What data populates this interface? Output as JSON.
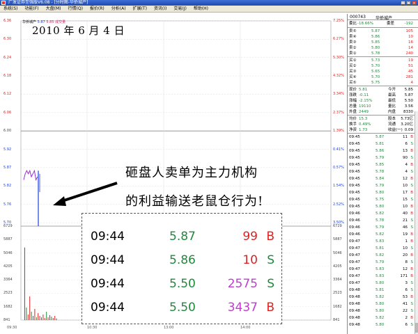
{
  "window": {
    "title": "广发证券至强版V6.08 - [分时图-华侨城产]",
    "controls": [
      "_",
      "□",
      "×"
    ]
  },
  "menu": [
    "系统(S)",
    "功能(F)",
    "大盘(M)",
    "行情(Q)",
    "报价(R)",
    "分析(A)",
    "扩展(T)",
    "资讯(I)",
    "交易(J)",
    "帮助(H)"
  ],
  "chart": {
    "date_caption": "2010 年 6 月 4 日",
    "legend": {
      "code": "华侨城产",
      "v1": "5.87",
      "v2": "5.85 成交量"
    },
    "price_ticks_left": [
      "6.36",
      "6.30",
      "6.24",
      "6.18",
      "6.12",
      "6.06",
      "6.00",
      "5.92",
      "5.87",
      "5.82",
      "5.76",
      "5.70"
    ],
    "pct_ticks_right": [
      "7.25%",
      "6.27%",
      "5.30%",
      "4.32%",
      "3.34%",
      "2.37%",
      "1.39%",
      "0.41%",
      "0.57%",
      "1.54%",
      "2.52%",
      "3.50%"
    ],
    "volume_ticks_left": [
      "6729",
      "5887",
      "5046",
      "4205",
      "3364",
      "2523",
      "1682",
      "841"
    ],
    "volume_ticks_right": [
      "6729",
      "5887",
      "5046",
      "4205",
      "3364",
      "2523",
      "1682",
      "841"
    ],
    "time_ticks": [
      "09:30",
      "10:30",
      "13:00",
      "14:00"
    ],
    "prev_close": 5.92,
    "price_min": 5.7,
    "price_max": 6.36,
    "volume_max": 6729,
    "opening_price_trace": [
      5.84,
      5.86,
      5.87,
      5.86,
      5.87,
      5.85,
      5.86,
      5.87,
      5.84,
      5.85
    ],
    "opening_dip_price": 5.5,
    "volume_bars": [
      5200,
      900,
      400,
      1700,
      600,
      300,
      800,
      200,
      500,
      300,
      200,
      400,
      150,
      600,
      200,
      350,
      250,
      150,
      300,
      120
    ],
    "annotation_line1": "砸盘人卖单为主力机构",
    "annotation_line2": "的利益输送老鼠仓行为!"
  },
  "tick_popup": [
    {
      "time": "09:44",
      "price": "5.87",
      "volume": "99",
      "dir": "B"
    },
    {
      "time": "09:44",
      "price": "5.86",
      "volume": "10",
      "dir": "S"
    },
    {
      "time": "09:44",
      "price": "5.50",
      "volume": "2575",
      "dir": "S"
    },
    {
      "time": "09:44",
      "price": "5.50",
      "volume": "3437",
      "dir": "B"
    }
  ],
  "side_panel": {
    "code": "000743",
    "name": "华侨城产",
    "weibi_label": "委比",
    "weibi_value": "-18.66%",
    "weicha_label": "委差",
    "weicha_value": "-192",
    "sell_book": [
      {
        "label": "卖⑤",
        "price": "5.87",
        "vol": "105"
      },
      {
        "label": "卖④",
        "price": "5.86",
        "vol": "10"
      },
      {
        "label": "卖③",
        "price": "5.85",
        "vol": "16"
      },
      {
        "label": "卖②",
        "price": "5.80",
        "vol": "14"
      },
      {
        "label": "卖①",
        "price": "5.78",
        "vol": "240"
      }
    ],
    "buy_book": [
      {
        "label": "买①",
        "price": "5.73",
        "vol": "19"
      },
      {
        "label": "买②",
        "price": "5.70",
        "vol": "51"
      },
      {
        "label": "买③",
        "price": "5.65",
        "vol": "45"
      },
      {
        "label": "买④",
        "price": "5.70",
        "vol": "281"
      },
      {
        "label": "买⑤",
        "price": "5.75",
        "vol": "4"
      }
    ],
    "stats": [
      {
        "l1": "现价",
        "v1": "5.81",
        "l2": "今开",
        "v2": "5.85"
      },
      {
        "l1": "涨跌",
        "v1": "-0.11",
        "l2": "最高",
        "v2": "5.87"
      },
      {
        "l1": "涨幅",
        "v1": "-2.15%",
        "l2": "最低",
        "v2": "5.50"
      },
      {
        "l1": "总量",
        "v1": "19110",
        "l2": "量比",
        "v2": "3.56"
      },
      {
        "l1": "外盘",
        "v1": "2449",
        "l2": "内盘",
        "v2": "8330"
      }
    ],
    "stats2": [
      {
        "l1": "均价",
        "v1": "15.3",
        "l2": "股本",
        "v2": "5.73亿"
      },
      {
        "l1": "换手",
        "v1": "0.49%",
        "l2": "流通",
        "v2": "3.20亿"
      },
      {
        "l1": "净资",
        "v1": "1.73",
        "l2": "收益(一)",
        "v2": "0.09"
      }
    ],
    "trades": [
      {
        "time": "09:45",
        "price": "5.87",
        "vol": "11",
        "dir": "B"
      },
      {
        "time": "09:45",
        "price": "5.81",
        "vol": "6",
        "dir": "S"
      },
      {
        "time": "09:45",
        "price": "5.86",
        "vol": "13",
        "dir": "B"
      },
      {
        "time": "09:45",
        "price": "5.79",
        "vol": "90",
        "dir": "S"
      },
      {
        "time": "09:45",
        "price": "5.85",
        "vol": "4",
        "dir": "B"
      },
      {
        "time": "09:45",
        "price": "5.78",
        "vol": "4",
        "dir": "S"
      },
      {
        "time": "09:45",
        "price": "5.84",
        "vol": "12",
        "dir": "B"
      },
      {
        "time": "09:45",
        "price": "5.79",
        "vol": "10",
        "dir": "S"
      },
      {
        "time": "09:45",
        "price": "5.80",
        "vol": "17",
        "dir": "B"
      },
      {
        "time": "09:45",
        "price": "5.75",
        "vol": "15",
        "dir": "S"
      },
      {
        "time": "09:45",
        "price": "5.80",
        "vol": "10",
        "dir": "B"
      },
      {
        "time": "09:46",
        "price": "5.82",
        "vol": "40",
        "dir": "B"
      },
      {
        "time": "09:46",
        "price": "5.78",
        "vol": "21",
        "dir": "S"
      },
      {
        "time": "09:46",
        "price": "5.79",
        "vol": "46",
        "dir": "S"
      },
      {
        "time": "09:46",
        "price": "5.82",
        "vol": "19",
        "dir": "B"
      },
      {
        "time": "09:47",
        "price": "5.83",
        "vol": "1",
        "dir": "B"
      },
      {
        "time": "09:47",
        "price": "5.81",
        "vol": "10",
        "dir": "S"
      },
      {
        "time": "09:47",
        "price": "5.82",
        "vol": "20",
        "dir": "B"
      },
      {
        "time": "09:47",
        "price": "5.79",
        "vol": "8",
        "dir": "S"
      },
      {
        "time": "09:47",
        "price": "5.83",
        "vol": "12",
        "dir": "B"
      },
      {
        "time": "09:47",
        "price": "5.83",
        "vol": "171",
        "dir": "B"
      },
      {
        "time": "09:47",
        "price": "5.80",
        "vol": "3",
        "dir": "S"
      },
      {
        "time": "09:48",
        "price": "5.81",
        "vol": "6",
        "dir": "S"
      },
      {
        "time": "09:48",
        "price": "5.82",
        "vol": "53",
        "dir": "B"
      },
      {
        "time": "09:48",
        "price": "5.80",
        "vol": "41",
        "dir": "S"
      },
      {
        "time": "09:48",
        "price": "5.80",
        "vol": "22",
        "dir": "S"
      },
      {
        "time": "09:48",
        "price": "5.82",
        "vol": "2",
        "dir": "B"
      },
      {
        "time": "09:48",
        "price": "5.80",
        "vol": "6",
        "dir": "S"
      }
    ]
  }
}
